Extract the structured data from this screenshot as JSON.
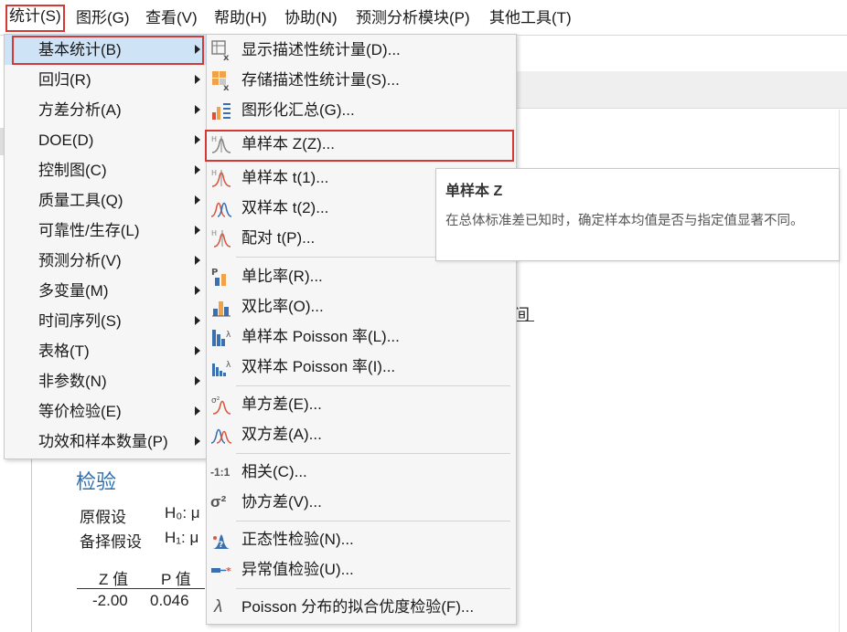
{
  "menubar": {
    "items": [
      "统计(S)",
      "图形(G)",
      "查看(V)",
      "帮助(H)",
      "协助(N)",
      "预测分析模块(P)",
      "其他工具(T)"
    ]
  },
  "stat_menu": {
    "items": [
      {
        "label": "基本统计(B)",
        "has_submenu": true,
        "highlighted": true
      },
      {
        "label": "回归(R)",
        "has_submenu": true
      },
      {
        "label": "方差分析(A)",
        "has_submenu": true
      },
      {
        "label": "DOE(D)",
        "has_submenu": true
      },
      {
        "label": "控制图(C)",
        "has_submenu": true
      },
      {
        "label": "质量工具(Q)",
        "has_submenu": true
      },
      {
        "label": "可靠性/生存(L)",
        "has_submenu": true
      },
      {
        "label": "预测分析(V)",
        "has_submenu": true
      },
      {
        "label": "多变量(M)",
        "has_submenu": true
      },
      {
        "label": "时间序列(S)",
        "has_submenu": true
      },
      {
        "label": "表格(T)",
        "has_submenu": true
      },
      {
        "label": "非参数(N)",
        "has_submenu": true
      },
      {
        "label": "等价检验(E)",
        "has_submenu": true
      },
      {
        "label": "功效和样本数量(P)",
        "has_submenu": true
      }
    ]
  },
  "basic_stats_submenu": {
    "items": [
      {
        "label": "显示描述性统计量(D)...",
        "icon": "display-descriptive-icon"
      },
      {
        "label": "存储描述性统计量(S)...",
        "icon": "store-descriptive-icon"
      },
      {
        "label": "图形化汇总(G)...",
        "icon": "graphical-summary-icon"
      },
      {
        "label": "单样本 Z(Z)...",
        "icon": "1-sample-z-icon",
        "highlighted": true
      },
      {
        "label": "单样本 t(1)...",
        "icon": "1-sample-t-icon"
      },
      {
        "label": "双样本 t(2)...",
        "icon": "2-sample-t-icon"
      },
      {
        "label": "配对 t(P)...",
        "icon": "paired-t-icon"
      },
      {
        "label": "单比率(R)...",
        "icon": "1-proportion-icon"
      },
      {
        "label": "双比率(O)...",
        "icon": "2-proportions-icon"
      },
      {
        "label": "单样本 Poisson 率(L)...",
        "icon": "1-sample-poisson-icon"
      },
      {
        "label": "双样本 Poisson 率(I)...",
        "icon": "2-sample-poisson-icon"
      },
      {
        "label": "单方差(E)...",
        "icon": "1-variance-icon"
      },
      {
        "label": "双方差(A)...",
        "icon": "2-variances-icon"
      },
      {
        "label": "相关(C)...",
        "icon": "correlation-icon",
        "glyph": "-1:1"
      },
      {
        "label": "协方差(V)...",
        "icon": "covariance-icon",
        "glyph": "σ²"
      },
      {
        "label": "正态性检验(N)...",
        "icon": "normality-test-icon"
      },
      {
        "label": "异常值检验(U)...",
        "icon": "outlier-test-icon"
      },
      {
        "label": "Poisson 分布的拟合优度检验(F)...",
        "icon": "poisson-gof-icon",
        "glyph": "λ"
      }
    ]
  },
  "tooltip": {
    "title": "单样本 Z",
    "body": "在总体标准差已知时，确定样本均值是否与指定值显著不同。"
  },
  "background": {
    "section_title": "检验",
    "null_label": "原假设",
    "null_value": "H₀: μ",
    "alt_label": "备择假设",
    "alt_value": "H₁: μ",
    "col_z": "Z 值",
    "col_p": "P 值",
    "z_value": "-2.00",
    "p_value": "0.046",
    "fragment": "间"
  },
  "colors": {
    "highlight_box": "#d43a35",
    "hover_fill": "#cfe3f7",
    "accent_blue": "#2a6fb5",
    "menu_bg": "#f6f6f6"
  }
}
